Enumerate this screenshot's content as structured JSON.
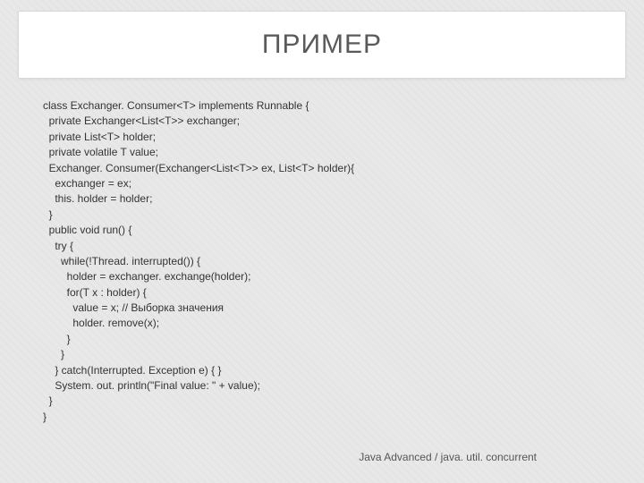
{
  "title": "ПРИМЕР",
  "code": {
    "lines": [
      "class Exchanger. Consumer<T> implements Runnable {",
      "  private Exchanger<List<T>> exchanger;",
      "  private List<T> holder;",
      "  private volatile T value;",
      "  Exchanger. Consumer(Exchanger<List<T>> ex, List<T> holder){",
      "    exchanger = ex;",
      "    this. holder = holder;",
      "  }",
      "  public void run() {",
      "    try {",
      "      while(!Thread. interrupted()) {",
      "        holder = exchanger. exchange(holder);",
      "        for(T x : holder) {",
      "          value = x; // Выборка значения",
      "          holder. remove(x);",
      "        }",
      "      }",
      "    } catch(Interrupted. Exception e) { }",
      "    System. out. println(\"Final value: \" + value);",
      "  }",
      "}"
    ]
  },
  "footer": "Java Advanced / java. util. concurrent"
}
